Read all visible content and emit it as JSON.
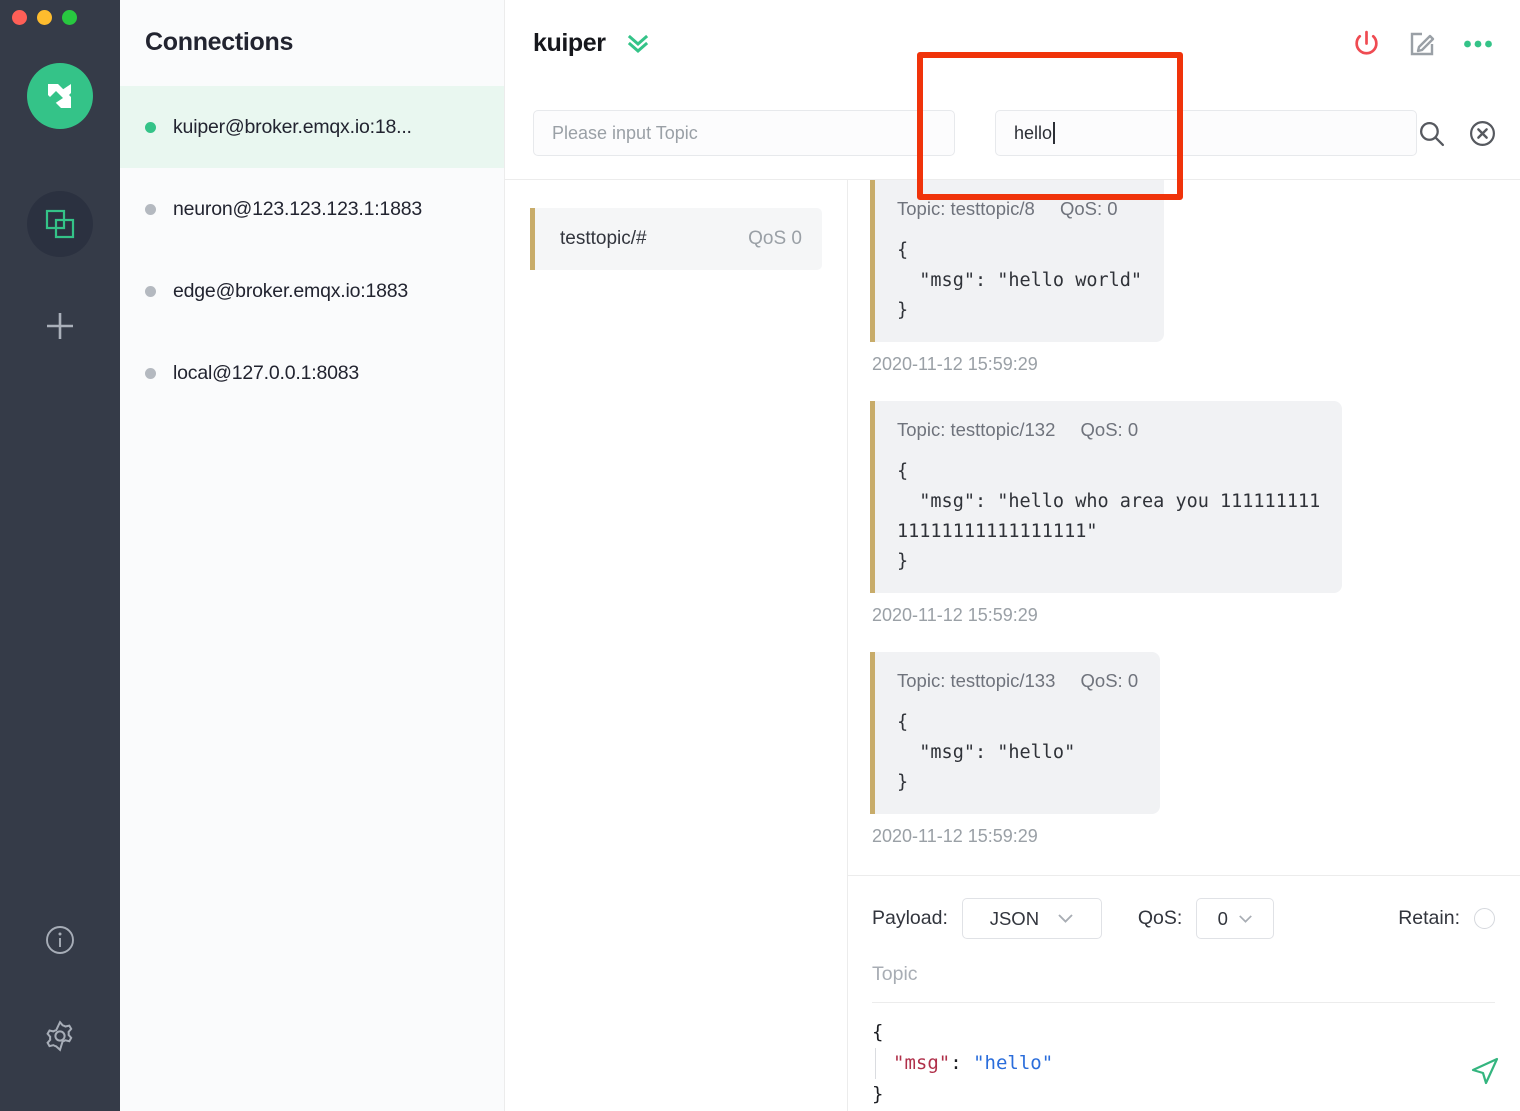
{
  "window": {
    "traffic_lights": [
      "close",
      "minimize",
      "maximize"
    ]
  },
  "rail": {
    "logo_icon": "mqttx-logo-icon",
    "items": [
      {
        "icon": "connections-icon",
        "name": "connections-tab",
        "active": true
      },
      {
        "icon": "plus-icon",
        "name": "new-connection-button",
        "active": false
      }
    ],
    "bottom_items": [
      {
        "icon": "info-icon",
        "name": "about-button"
      },
      {
        "icon": "gear-icon",
        "name": "settings-button"
      }
    ]
  },
  "connections": {
    "title": "Connections",
    "items": [
      {
        "label": "kuiper@broker.emqx.io:18...",
        "active": true,
        "status": "connected"
      },
      {
        "label": "neuron@123.123.123.1:1883",
        "active": false,
        "status": "disconnected"
      },
      {
        "label": "edge@broker.emqx.io:1883",
        "active": false,
        "status": "disconnected"
      },
      {
        "label": "local@127.0.0.1:8083",
        "active": false,
        "status": "disconnected"
      }
    ]
  },
  "topbar": {
    "title": "kuiper",
    "collapse_icon": "double-chevron-down-icon",
    "actions": [
      {
        "icon": "power-icon",
        "name": "disconnect-button",
        "color": "#ef4b52"
      },
      {
        "icon": "edit-icon",
        "name": "edit-connection-button",
        "color": "#9aa0a6"
      },
      {
        "icon": "ellipsis-icon",
        "name": "more-options-button",
        "color": "#34c388"
      }
    ]
  },
  "search": {
    "topic_placeholder": "Please input Topic",
    "keyword_value": "hello",
    "keyword_placeholder": "",
    "search_icon": "search-icon",
    "clear_icon": "clear-circle-icon"
  },
  "subscriptions": [
    {
      "topic": "testtopic/#",
      "qos": "QoS 0",
      "accent": "#c8ac6a"
    }
  ],
  "messages": [
    {
      "topic_label": "Topic: testtopic/8",
      "qos_label": "QoS: 0",
      "payload": "{\n  \"msg\": \"hello world\"\n}",
      "time": "2020-11-12 15:59:29"
    },
    {
      "topic_label": "Topic: testtopic/132",
      "qos_label": "QoS: 0",
      "payload": "{\n  \"msg\": \"hello who area you 111111111\n11111111111111111\"\n}",
      "time": "2020-11-12 15:59:29"
    },
    {
      "topic_label": "Topic: testtopic/133",
      "qos_label": "QoS: 0",
      "payload": "{\n  \"msg\": \"hello\"\n}",
      "time": "2020-11-12 15:59:29"
    }
  ],
  "publish": {
    "payload_label": "Payload:",
    "payload_value": "JSON",
    "qos_label": "QoS:",
    "qos_value": "0",
    "retain_label": "Retain:",
    "retain_checked": false,
    "topic_placeholder": "Topic",
    "editor": {
      "line_open": "{",
      "key": "\"msg\"",
      "colon": ": ",
      "value": "\"hello\"",
      "line_close": "}"
    },
    "send_icon": "send-paper-plane-icon"
  },
  "annotation": {
    "type": "highlight-rectangle",
    "color": "#f0330a"
  }
}
